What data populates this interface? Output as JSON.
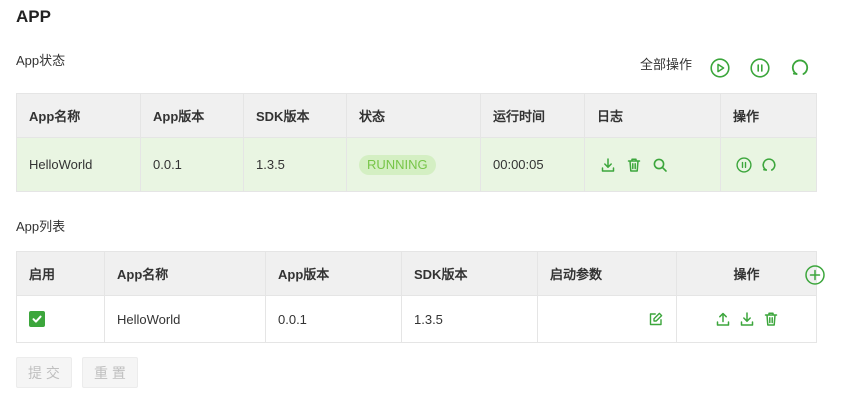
{
  "page": {
    "title": "APP"
  },
  "colors": {
    "accent": "#3ca63c",
    "running_row_bg": "#e9f5e2",
    "badge_bg": "#d4efc3",
    "badge_text": "#77c548",
    "header_bg": "#f0f0f0",
    "border": "#e5e5e5",
    "disabled_bg": "#f5f5f5",
    "disabled_text": "#bfbfbf",
    "text": "#333333"
  },
  "status_section": {
    "title": "App状态",
    "bulk_actions": {
      "label": "全部操作",
      "icons": [
        "play-circle-icon",
        "pause-circle-icon",
        "refresh-icon"
      ]
    },
    "columns": [
      "App名称",
      "App版本",
      "SDK版本",
      "状态",
      "运行时间",
      "日志",
      "操作"
    ],
    "rows": [
      {
        "name": "HelloWorld",
        "version": "0.0.1",
        "sdk_version": "1.3.5",
        "status": "RUNNING",
        "uptime": "00:00:05",
        "log_actions": [
          "download-icon",
          "trash-icon",
          "search-icon"
        ],
        "actions": [
          "pause-circle-icon",
          "refresh-icon"
        ]
      }
    ]
  },
  "list_section": {
    "title": "App列表",
    "add_icon": "plus-circle-icon",
    "columns": [
      "启用",
      "App名称",
      "App版本",
      "SDK版本",
      "启动参数",
      "操作"
    ],
    "rows": [
      {
        "enabled": true,
        "name": "HelloWorld",
        "version": "0.0.1",
        "sdk_version": "1.3.5",
        "launch_params": "",
        "param_actions": [
          "edit-icon"
        ],
        "actions": [
          "upload-icon",
          "download-icon",
          "trash-icon"
        ]
      }
    ]
  },
  "form_buttons": {
    "submit": "提 交",
    "reset": "重 置",
    "disabled": true
  }
}
